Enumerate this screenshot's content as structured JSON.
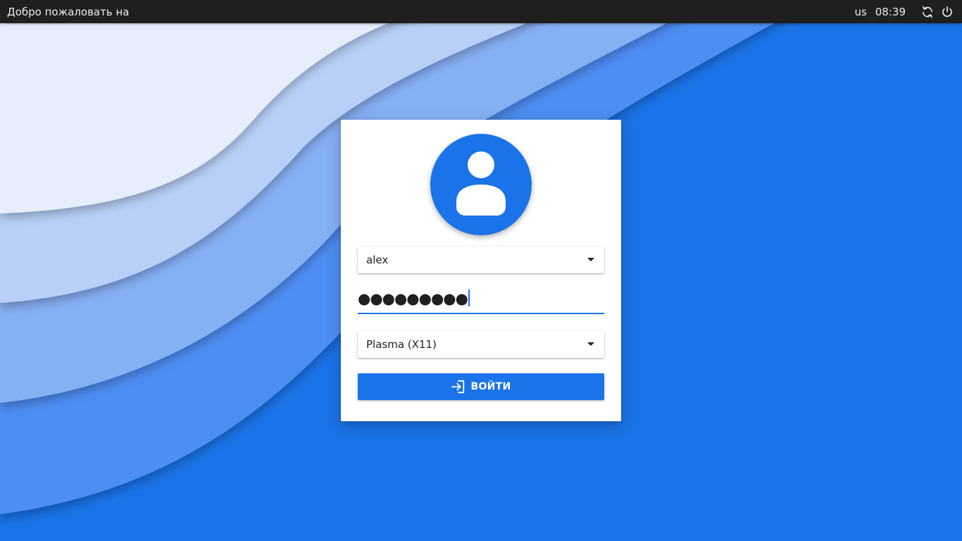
{
  "topbar": {
    "welcome_text": "Добро пожаловать на",
    "keyboard_layout": "us",
    "clock": "08:39"
  },
  "login": {
    "username": "alex",
    "password_mask": "●●●●●●●●●",
    "session": "Plasma (X11)",
    "login_label": "ВОЙТИ"
  },
  "colors": {
    "accent": "#1a73e8",
    "topbar_bg": "#1f1f1f",
    "card_bg": "#ffffff"
  },
  "icons": {
    "avatar": "user-avatar-icon",
    "restart": "restart-icon",
    "power": "power-icon",
    "login": "login-arrow-icon",
    "dropdown": "chevron-down-icon"
  }
}
